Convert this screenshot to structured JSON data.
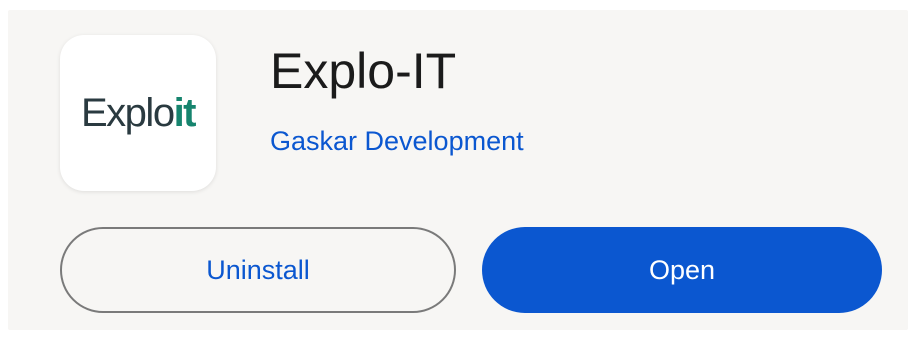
{
  "app": {
    "icon_name": "exploit-logo",
    "logo_text_main": "Explo",
    "logo_text_accent": "it",
    "title": "Explo-IT",
    "developer": "Gaskar Development"
  },
  "actions": {
    "uninstall_label": "Uninstall",
    "open_label": "Open"
  },
  "colors": {
    "accent_blue": "#0b57d0",
    "logo_green": "#16846e",
    "logo_dark": "#2a3a40",
    "card_background": "#f7f6f4"
  }
}
